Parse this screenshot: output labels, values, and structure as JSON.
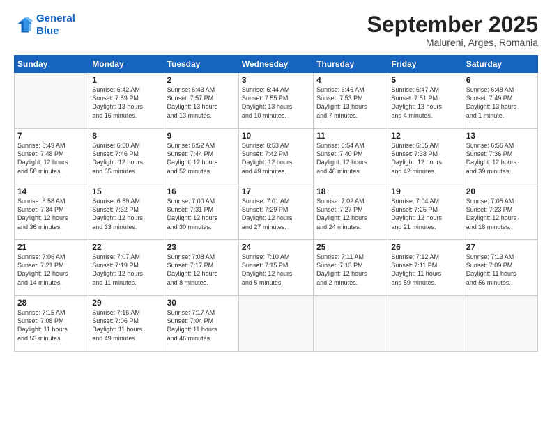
{
  "logo": {
    "line1": "General",
    "line2": "Blue"
  },
  "title": "September 2025",
  "location": "Malureni, Arges, Romania",
  "days_of_week": [
    "Sunday",
    "Monday",
    "Tuesday",
    "Wednesday",
    "Thursday",
    "Friday",
    "Saturday"
  ],
  "weeks": [
    [
      {
        "day": "",
        "info": ""
      },
      {
        "day": "1",
        "info": "Sunrise: 6:42 AM\nSunset: 7:59 PM\nDaylight: 13 hours\nand 16 minutes."
      },
      {
        "day": "2",
        "info": "Sunrise: 6:43 AM\nSunset: 7:57 PM\nDaylight: 13 hours\nand 13 minutes."
      },
      {
        "day": "3",
        "info": "Sunrise: 6:44 AM\nSunset: 7:55 PM\nDaylight: 13 hours\nand 10 minutes."
      },
      {
        "day": "4",
        "info": "Sunrise: 6:46 AM\nSunset: 7:53 PM\nDaylight: 13 hours\nand 7 minutes."
      },
      {
        "day": "5",
        "info": "Sunrise: 6:47 AM\nSunset: 7:51 PM\nDaylight: 13 hours\nand 4 minutes."
      },
      {
        "day": "6",
        "info": "Sunrise: 6:48 AM\nSunset: 7:49 PM\nDaylight: 13 hours\nand 1 minute."
      }
    ],
    [
      {
        "day": "7",
        "info": "Sunrise: 6:49 AM\nSunset: 7:48 PM\nDaylight: 12 hours\nand 58 minutes."
      },
      {
        "day": "8",
        "info": "Sunrise: 6:50 AM\nSunset: 7:46 PM\nDaylight: 12 hours\nand 55 minutes."
      },
      {
        "day": "9",
        "info": "Sunrise: 6:52 AM\nSunset: 7:44 PM\nDaylight: 12 hours\nand 52 minutes."
      },
      {
        "day": "10",
        "info": "Sunrise: 6:53 AM\nSunset: 7:42 PM\nDaylight: 12 hours\nand 49 minutes."
      },
      {
        "day": "11",
        "info": "Sunrise: 6:54 AM\nSunset: 7:40 PM\nDaylight: 12 hours\nand 46 minutes."
      },
      {
        "day": "12",
        "info": "Sunrise: 6:55 AM\nSunset: 7:38 PM\nDaylight: 12 hours\nand 42 minutes."
      },
      {
        "day": "13",
        "info": "Sunrise: 6:56 AM\nSunset: 7:36 PM\nDaylight: 12 hours\nand 39 minutes."
      }
    ],
    [
      {
        "day": "14",
        "info": "Sunrise: 6:58 AM\nSunset: 7:34 PM\nDaylight: 12 hours\nand 36 minutes."
      },
      {
        "day": "15",
        "info": "Sunrise: 6:59 AM\nSunset: 7:32 PM\nDaylight: 12 hours\nand 33 minutes."
      },
      {
        "day": "16",
        "info": "Sunrise: 7:00 AM\nSunset: 7:31 PM\nDaylight: 12 hours\nand 30 minutes."
      },
      {
        "day": "17",
        "info": "Sunrise: 7:01 AM\nSunset: 7:29 PM\nDaylight: 12 hours\nand 27 minutes."
      },
      {
        "day": "18",
        "info": "Sunrise: 7:02 AM\nSunset: 7:27 PM\nDaylight: 12 hours\nand 24 minutes."
      },
      {
        "day": "19",
        "info": "Sunrise: 7:04 AM\nSunset: 7:25 PM\nDaylight: 12 hours\nand 21 minutes."
      },
      {
        "day": "20",
        "info": "Sunrise: 7:05 AM\nSunset: 7:23 PM\nDaylight: 12 hours\nand 18 minutes."
      }
    ],
    [
      {
        "day": "21",
        "info": "Sunrise: 7:06 AM\nSunset: 7:21 PM\nDaylight: 12 hours\nand 14 minutes."
      },
      {
        "day": "22",
        "info": "Sunrise: 7:07 AM\nSunset: 7:19 PM\nDaylight: 12 hours\nand 11 minutes."
      },
      {
        "day": "23",
        "info": "Sunrise: 7:08 AM\nSunset: 7:17 PM\nDaylight: 12 hours\nand 8 minutes."
      },
      {
        "day": "24",
        "info": "Sunrise: 7:10 AM\nSunset: 7:15 PM\nDaylight: 12 hours\nand 5 minutes."
      },
      {
        "day": "25",
        "info": "Sunrise: 7:11 AM\nSunset: 7:13 PM\nDaylight: 12 hours\nand 2 minutes."
      },
      {
        "day": "26",
        "info": "Sunrise: 7:12 AM\nSunset: 7:11 PM\nDaylight: 11 hours\nand 59 minutes."
      },
      {
        "day": "27",
        "info": "Sunrise: 7:13 AM\nSunset: 7:09 PM\nDaylight: 11 hours\nand 56 minutes."
      }
    ],
    [
      {
        "day": "28",
        "info": "Sunrise: 7:15 AM\nSunset: 7:08 PM\nDaylight: 11 hours\nand 53 minutes."
      },
      {
        "day": "29",
        "info": "Sunrise: 7:16 AM\nSunset: 7:06 PM\nDaylight: 11 hours\nand 49 minutes."
      },
      {
        "day": "30",
        "info": "Sunrise: 7:17 AM\nSunset: 7:04 PM\nDaylight: 11 hours\nand 46 minutes."
      },
      {
        "day": "",
        "info": ""
      },
      {
        "day": "",
        "info": ""
      },
      {
        "day": "",
        "info": ""
      },
      {
        "day": "",
        "info": ""
      }
    ]
  ]
}
